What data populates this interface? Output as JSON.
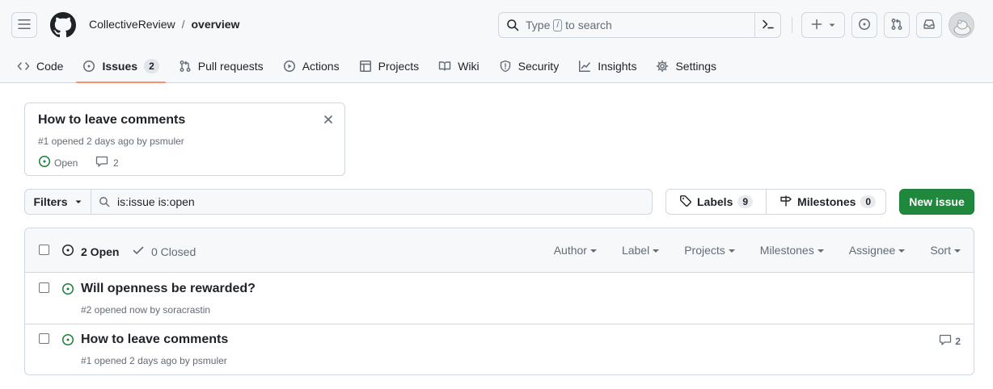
{
  "header": {
    "owner": "CollectiveReview",
    "separator": "/",
    "repo": "overview",
    "search_prefix": "Type",
    "search_key": "/",
    "search_suffix": "to search"
  },
  "tabs": [
    {
      "label": "Code"
    },
    {
      "label": "Issues",
      "count": "2"
    },
    {
      "label": "Pull requests"
    },
    {
      "label": "Actions"
    },
    {
      "label": "Projects"
    },
    {
      "label": "Wiki"
    },
    {
      "label": "Security"
    },
    {
      "label": "Insights"
    },
    {
      "label": "Settings"
    }
  ],
  "pinned": {
    "title": "How to leave comments",
    "meta": "#1 opened 2 days ago by psmuler",
    "status": "Open",
    "comments": "2"
  },
  "filters": {
    "button_label": "Filters",
    "query": "is:issue is:open",
    "labels_label": "Labels",
    "labels_count": "9",
    "milestones_label": "Milestones",
    "milestones_count": "0",
    "new_issue_label": "New issue"
  },
  "list": {
    "open_label": "2 Open",
    "closed_label": "0 Closed",
    "sort_menus": [
      "Author",
      "Label",
      "Projects",
      "Milestones",
      "Assignee",
      "Sort"
    ],
    "issues": [
      {
        "title": "Will openness be rewarded?",
        "meta": "#2 opened now by soracrastin",
        "comments": ""
      },
      {
        "title": "How to leave comments",
        "meta": "#1 opened 2 days ago by psmuler",
        "comments": "2"
      }
    ]
  },
  "colors": {
    "open_green": "#1a7f37",
    "primary_button": "#1f883d",
    "active_tab_underline": "#fd8c73",
    "muted_text": "#636c76",
    "border": "#d0d7de"
  }
}
